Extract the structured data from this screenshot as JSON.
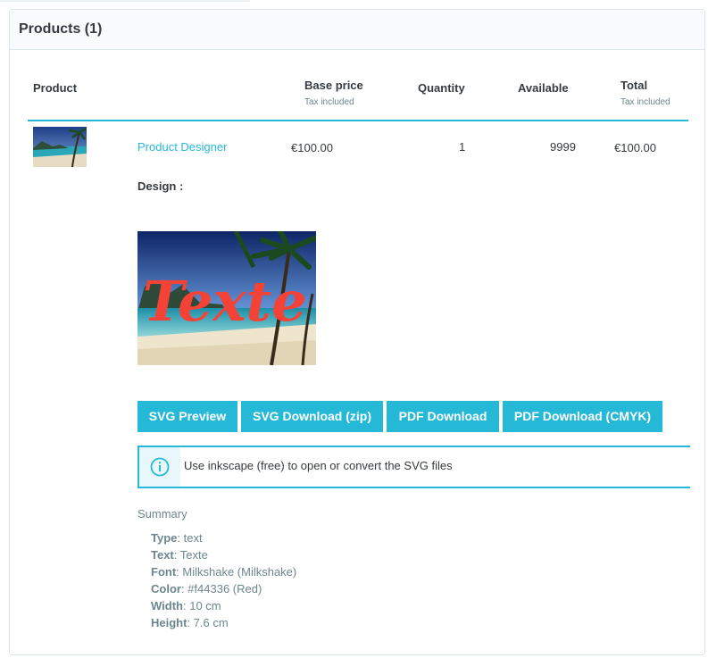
{
  "panel": {
    "title": "Products (1)"
  },
  "table": {
    "headers": {
      "product": "Product",
      "base_price": "Base price",
      "base_price_sub": "Tax included",
      "quantity": "Quantity",
      "available": "Available",
      "total": "Total",
      "total_sub": "Tax included"
    },
    "row": {
      "name": "Product Designer",
      "price": "€100.00",
      "quantity": "1",
      "available": "9999",
      "total": "€100.00"
    }
  },
  "design": {
    "label": "Design :",
    "image_text": "Texte",
    "text_color": "#f44336"
  },
  "buttons": {
    "svg_preview": "SVG Preview",
    "svg_download": "SVG Download (zip)",
    "pdf_download": "PDF Download",
    "pdf_download_cmyk": "PDF Download (CMYK)"
  },
  "alert": {
    "text": "Use inkscape (free) to open or convert the SVG files",
    "icon": "info-icon"
  },
  "summary": {
    "title": "Summary",
    "items": [
      {
        "key": "Type",
        "value": ": text"
      },
      {
        "key": "Text",
        "value": ": Texte"
      },
      {
        "key": "Font",
        "value": ": Milkshake (Milkshake)"
      },
      {
        "key": "Color",
        "value": ": #f44336 (Red)"
      },
      {
        "key": "Width",
        "value": ": 10 cm"
      },
      {
        "key": "Height",
        "value": ": 7.6 cm"
      }
    ]
  },
  "colors": {
    "accent": "#25b9d7",
    "text": "#363a41",
    "muted": "#6c868e"
  }
}
